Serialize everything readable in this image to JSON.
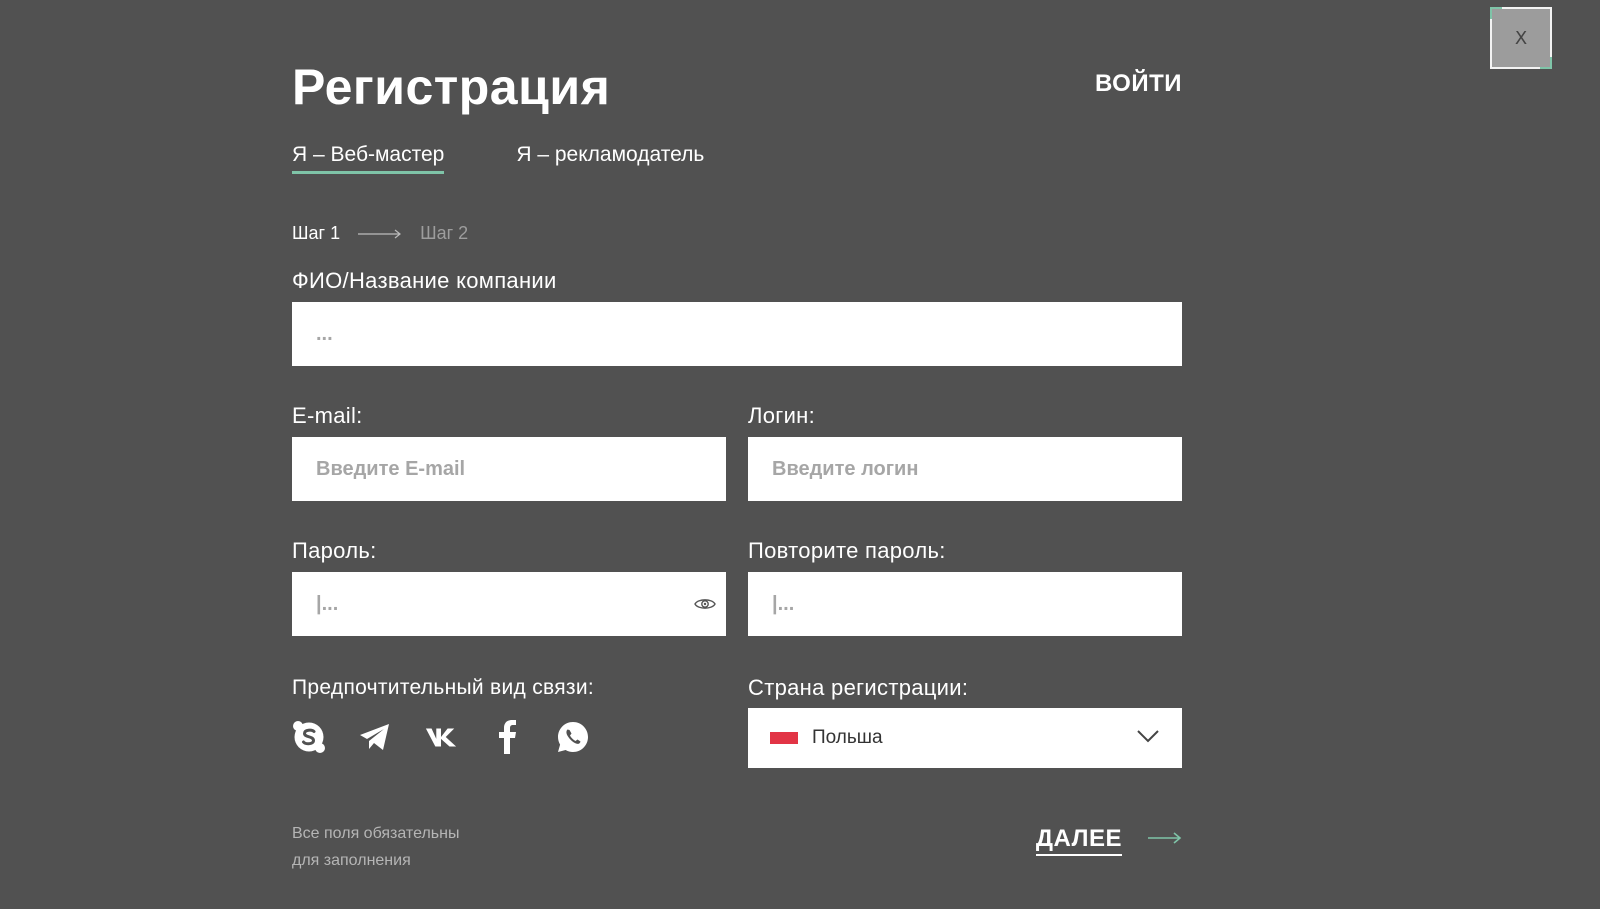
{
  "close": {
    "label": "X"
  },
  "header": {
    "title": "Регистрация",
    "login_link": "ВОЙТИ"
  },
  "tabs": [
    {
      "label": "Я – Веб-мастер",
      "active": true
    },
    {
      "label": "Я – рекламодатель",
      "active": false
    }
  ],
  "steps": {
    "step1": "Шаг 1",
    "step2": "Шаг 2"
  },
  "fields": {
    "name": {
      "label": "ФИО/Название компании",
      "placeholder": "..."
    },
    "email": {
      "label": "E-mail:",
      "placeholder": "Введите E-mail"
    },
    "login": {
      "label": "Логин:",
      "placeholder": "Введите логин"
    },
    "password": {
      "label": "Пароль:",
      "placeholder": "|..."
    },
    "password_repeat": {
      "label": "Повторите пароль:",
      "placeholder": "|..."
    }
  },
  "contact": {
    "label": "Предпочтительный вид связи:",
    "icons": [
      "skype-icon",
      "telegram-icon",
      "vk-icon",
      "facebook-icon",
      "whatsapp-icon"
    ]
  },
  "country": {
    "label": "Страна регистрации:",
    "selected": "Польша",
    "flag_color": "#e23445"
  },
  "footer": {
    "required_note": "Все поля обязательны\nдля заполнения",
    "next_label": "ДАЛЕЕ"
  },
  "colors": {
    "background": "#515151",
    "accent": "#7fc4a8"
  }
}
